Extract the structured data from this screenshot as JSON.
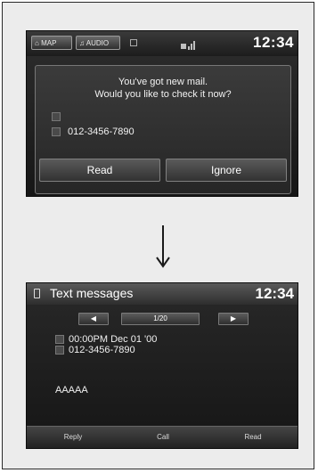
{
  "screen1": {
    "status": {
      "map_label": "MAP",
      "audio_label": "AUDIO",
      "clock": "12:34"
    },
    "dialog": {
      "line1": "You've got new mail.",
      "line2": "Would you like to check it now?",
      "phone": "012-3456-7890",
      "read_label": "Read",
      "ignore_label": "Ignore"
    }
  },
  "screen2": {
    "header": {
      "title": "Text messages",
      "clock": "12:34"
    },
    "pager": {
      "prev_symbol": "◀",
      "page": "1/20",
      "next_symbol": "▶"
    },
    "message": {
      "datetime": "00:00PM Dec 01 '00",
      "phone": "012-3456-7890",
      "body": "AAAAA"
    },
    "actions": {
      "reply_label": "Reply",
      "call_label": "Call",
      "read_label": "Read"
    }
  },
  "icons": [
    "home-icon",
    "music-note-icon",
    "phone-icon",
    "signal-icon",
    "envelope-icon",
    "down-arrow-icon"
  ]
}
